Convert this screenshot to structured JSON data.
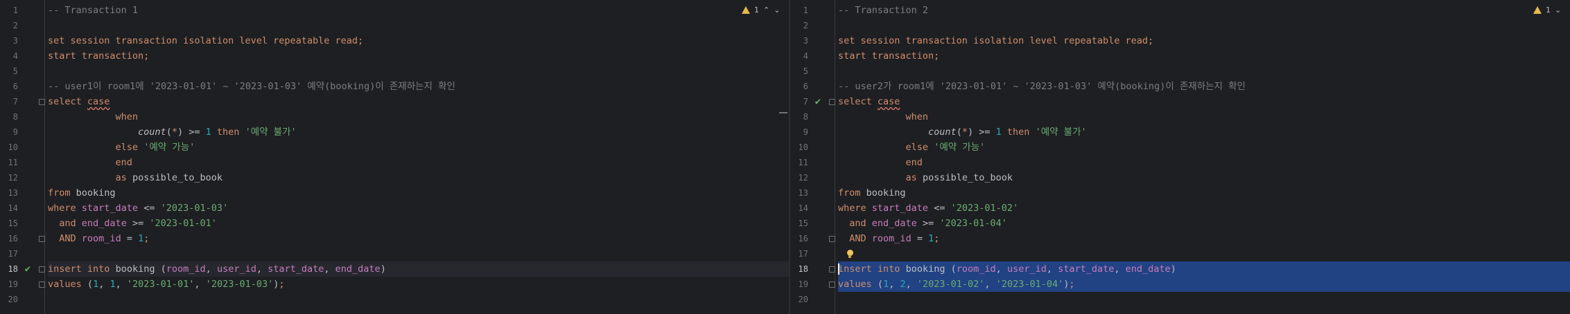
{
  "left_editor": {
    "inspection_count": "1",
    "lines": [
      {
        "n": "1"
      },
      {
        "n": "2"
      },
      {
        "n": "3"
      },
      {
        "n": "4"
      },
      {
        "n": "5"
      },
      {
        "n": "6"
      },
      {
        "n": "7"
      },
      {
        "n": "8"
      },
      {
        "n": "9"
      },
      {
        "n": "10"
      },
      {
        "n": "11"
      },
      {
        "n": "12"
      },
      {
        "n": "13"
      },
      {
        "n": "14"
      },
      {
        "n": "15"
      },
      {
        "n": "16"
      },
      {
        "n": "17"
      },
      {
        "n": "18"
      },
      {
        "n": "19"
      },
      {
        "n": "20"
      }
    ],
    "t": {
      "comment1": "-- Transaction 1",
      "l3": "set session transaction isolation level repeatable read;",
      "l4": "start transaction;",
      "comment6": "-- user1이 room1에 '2023-01-01' ~ '2023-01-03' 예약(booking)이 존재하는지 확인",
      "select": "select",
      "case": "case",
      "when": "when",
      "count": "count",
      "star": "*",
      "ge": " >= ",
      "one": "1",
      "then": "then",
      "s_unavail": "'예약 불가'",
      "else": "else",
      "s_avail": "'예약 가능'",
      "end": "end",
      "as": "as",
      "alias": "possible_to_book",
      "from": "from",
      "booking": "booking",
      "where": "where",
      "start_date": "start_date",
      "le": " <= ",
      "d_where": "'2023-01-03'",
      "and_low": "and",
      "end_date": "end_date",
      "d_and": "'2023-01-01'",
      "AND": "AND",
      "room_id": "room_id",
      "eq": " = ",
      "semi": ";",
      "insert": "insert",
      "into": "into",
      "user_id": "user_id",
      "values": "values",
      "v1": "1",
      "v2": "1",
      "vd1": "'2023-01-01'",
      "vd2": "'2023-01-03'"
    }
  },
  "right_editor": {
    "inspection_count": "1",
    "t": {
      "comment1": "-- Transaction 2",
      "l3": "set session transaction isolation level repeatable read;",
      "l4": "start transaction;",
      "comment6": "-- user2가 room1에 '2023-01-01' ~ '2023-01-03' 예약(booking)이 존재하는지 확인",
      "select": "select",
      "case": "case",
      "when": "when",
      "count": "count",
      "star": "*",
      "ge": " >= ",
      "one": "1",
      "then": "then",
      "s_unavail": "'예약 불가'",
      "else": "else",
      "s_avail": "'예약 가능'",
      "end": "end",
      "as": "as",
      "alias": "possible_to_book",
      "from": "from",
      "booking": "booking",
      "where": "where",
      "start_date": "start_date",
      "le": " <= ",
      "d_where": "'2023-01-02'",
      "and_low": "and",
      "end_date": "end_date",
      "d_and": "'2023-01-04'",
      "AND": "AND",
      "room_id": "room_id",
      "eq": " = ",
      "semi": ";",
      "insert": "insert",
      "into": "into",
      "user_id": "user_id",
      "values": "values",
      "v1": "1",
      "v2": "2",
      "vd1": "'2023-01-02'",
      "vd2": "'2023-01-04'"
    }
  },
  "icons": {
    "warning": "warning-triangle-icon",
    "up": "chevron-up-icon",
    "down": "chevron-down-icon",
    "check": "checkmark-icon",
    "bulb": "lightbulb-icon"
  },
  "glyphs": {
    "up": "⌃",
    "down": "⌄",
    "check": "✔"
  },
  "colors": {
    "keyword": "#cf8e6d",
    "string": "#6aab73",
    "number": "#2aacb8",
    "column": "#c77dbb",
    "comment": "#7a7e85",
    "selection": "#214283"
  }
}
